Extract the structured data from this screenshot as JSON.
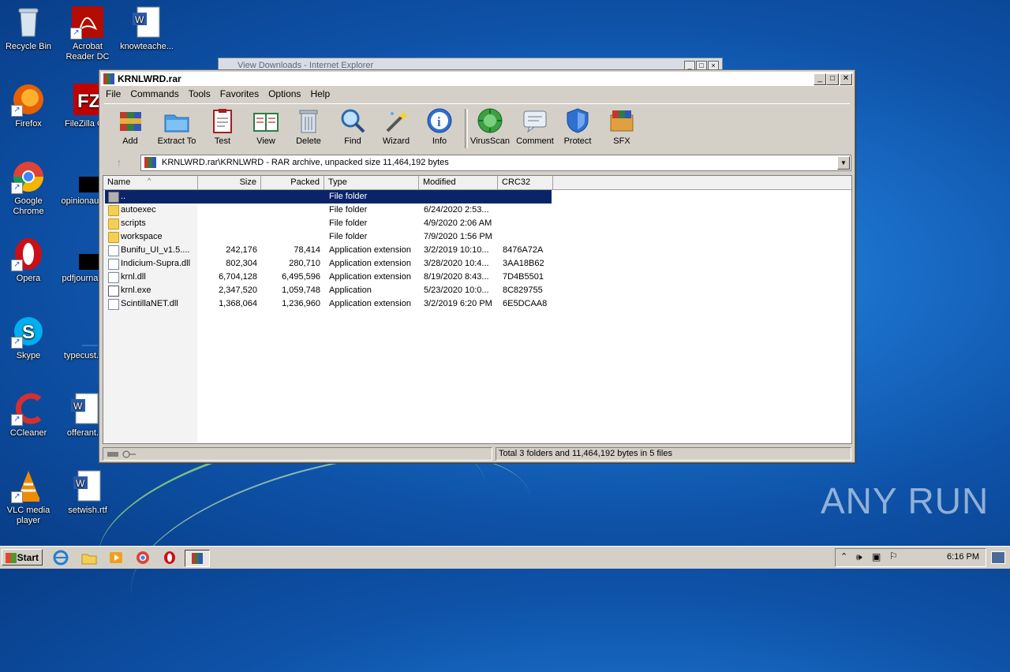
{
  "desktop": {
    "icons": [
      {
        "label": "Recycle Bin",
        "icon": "recycle-bin-icon"
      },
      {
        "label": "Acrobat Reader DC",
        "icon": "acrobat-icon"
      },
      {
        "label": "knowteache...",
        "icon": "word-doc-icon"
      },
      {
        "label": "Firefox",
        "icon": "firefox-icon"
      },
      {
        "label": "FileZilla C...",
        "icon": "filezilla-icon"
      },
      {
        "label": "Google Chrome",
        "icon": "chrome-icon"
      },
      {
        "label": "opinionau...",
        "icon": "black-file-icon"
      },
      {
        "label": "Opera",
        "icon": "opera-icon"
      },
      {
        "label": "pdfjourna...",
        "icon": "black-file-icon"
      },
      {
        "label": "Skype",
        "icon": "skype-icon"
      },
      {
        "label": "typecust...",
        "icon": "blank-file-icon"
      },
      {
        "label": "CCleaner",
        "icon": "ccleaner-icon"
      },
      {
        "label": "offerant...",
        "icon": "word-doc-icon"
      },
      {
        "label": "VLC media player",
        "icon": "vlc-icon"
      },
      {
        "label": "setwish.rtf",
        "icon": "word-doc-icon"
      }
    ]
  },
  "background_window": {
    "title": "View Downloads - Internet Explorer"
  },
  "window": {
    "title": "KRNLWRD.rar",
    "menu": [
      "File",
      "Commands",
      "Tools",
      "Favorites",
      "Options",
      "Help"
    ],
    "toolbar": [
      {
        "label": "Add",
        "icon": "add-archive-icon"
      },
      {
        "label": "Extract To",
        "icon": "extract-folder-icon"
      },
      {
        "label": "Test",
        "icon": "test-clipboard-icon"
      },
      {
        "label": "View",
        "icon": "view-book-icon"
      },
      {
        "label": "Delete",
        "icon": "trash-icon"
      },
      {
        "label": "Find",
        "icon": "magnifier-icon"
      },
      {
        "label": "Wizard",
        "icon": "magic-wand-icon"
      },
      {
        "label": "Info",
        "icon": "info-icon"
      },
      {
        "label": "VirusScan",
        "icon": "virus-icon"
      },
      {
        "label": "Comment",
        "icon": "comment-icon"
      },
      {
        "label": "Protect",
        "icon": "shield-icon"
      },
      {
        "label": "SFX",
        "icon": "sfx-box-icon"
      }
    ],
    "address": "KRNLWRD.rar\\KRNLWRD - RAR archive, unpacked size 11,464,192 bytes",
    "columns": [
      "Name",
      "Size",
      "Packed",
      "Type",
      "Modified",
      "CRC32"
    ],
    "rows": [
      {
        "name": "..",
        "size": "",
        "packed": "",
        "type": "File folder",
        "modified": "",
        "crc": "",
        "kind": "up"
      },
      {
        "name": "autoexec",
        "size": "",
        "packed": "",
        "type": "File folder",
        "modified": "6/24/2020 2:53...",
        "crc": "",
        "kind": "folder"
      },
      {
        "name": "scripts",
        "size": "",
        "packed": "",
        "type": "File folder",
        "modified": "4/9/2020 2:06 AM",
        "crc": "",
        "kind": "folder"
      },
      {
        "name": "workspace",
        "size": "",
        "packed": "",
        "type": "File folder",
        "modified": "7/9/2020 1:56 PM",
        "crc": "",
        "kind": "folder"
      },
      {
        "name": "Bunifu_UI_v1.5....",
        "size": "242,176",
        "packed": "78,414",
        "type": "Application extension",
        "modified": "3/2/2019 10:10...",
        "crc": "8476A72A",
        "kind": "dll"
      },
      {
        "name": "Indicium-Supra.dll",
        "size": "802,304",
        "packed": "280,710",
        "type": "Application extension",
        "modified": "3/28/2020 10:4...",
        "crc": "3AA18B62",
        "kind": "dll"
      },
      {
        "name": "krnl.dll",
        "size": "6,704,128",
        "packed": "6,495,596",
        "type": "Application extension",
        "modified": "8/19/2020 8:43...",
        "crc": "7D4B5501",
        "kind": "dll"
      },
      {
        "name": "krnl.exe",
        "size": "2,347,520",
        "packed": "1,059,748",
        "type": "Application",
        "modified": "5/23/2020 10:0...",
        "crc": "8C829755",
        "kind": "exe"
      },
      {
        "name": "ScintillaNET.dll",
        "size": "1,368,064",
        "packed": "1,236,960",
        "type": "Application extension",
        "modified": "3/2/2019 6:20 PM",
        "crc": "6E5DCAA8",
        "kind": "dll"
      }
    ],
    "status": "Total 3 folders and 11,464,192 bytes in 5 files"
  },
  "taskbar": {
    "start_label": "Start",
    "clock": "6:16 PM"
  },
  "watermark": "ANY RUN"
}
